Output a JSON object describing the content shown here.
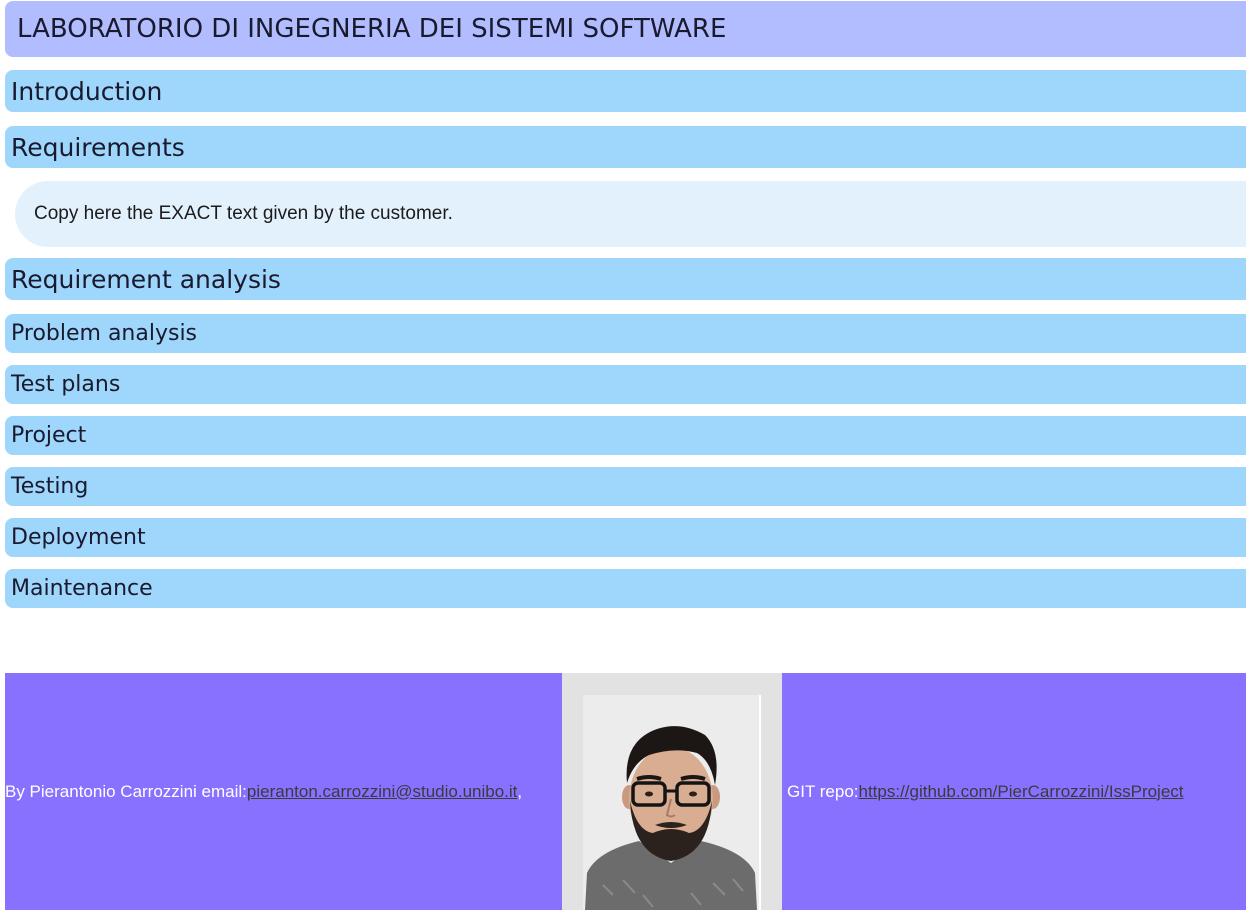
{
  "page": {
    "title": "LABORATORIO DI INGEGNERIA DEI SISTEMI SOFTWARE"
  },
  "sections": {
    "introduction": "Introduction",
    "requirements": "Requirements",
    "requirements_text": "Copy here the EXACT text given by the customer.",
    "requirement_analysis": "Requirement analysis",
    "problem_analysis": "Problem analysis",
    "test_plans": "Test plans",
    "project": "Project",
    "testing": "Testing",
    "deployment": "Deployment",
    "maintenance": "Maintenance"
  },
  "footer": {
    "author_prefix": "By Pierantonio Carrozzini email: ",
    "email": "pieranton.carrozzini@studio.unibo.it",
    "email_suffix": ",",
    "git_prefix": "GIT repo: ",
    "git_url": "https://github.com/PierCarrozzini/IssProject",
    "photo_icon": "author-photo"
  },
  "colors": {
    "title_bg": "#b2bdff",
    "section_bg": "#9fd6fc",
    "requirements_box_bg": "#e3f1fd",
    "footer_bg": "#8871ff",
    "photo_cell_bg": "#e2e2e2"
  }
}
